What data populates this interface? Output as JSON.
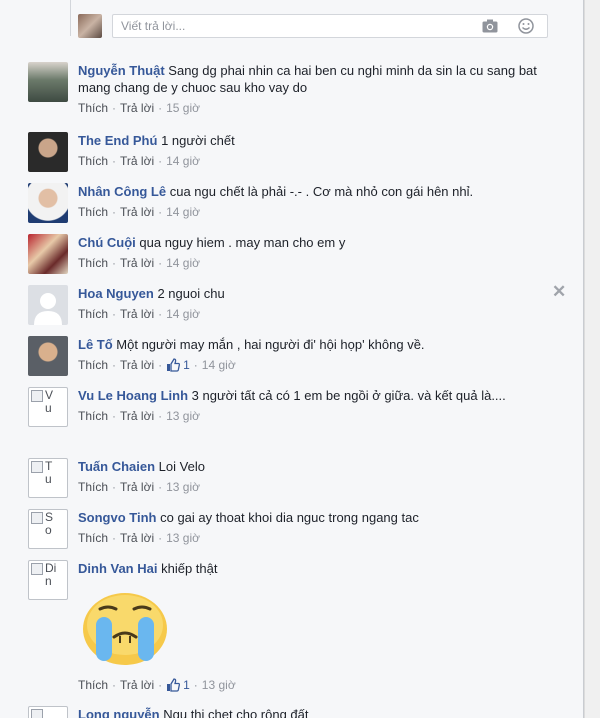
{
  "reply": {
    "placeholder": "Viết trả lời..."
  },
  "labels": {
    "like": "Thích",
    "reply": "Trả lời",
    "sep": "·"
  },
  "comments": [
    {
      "author": "Nguyễn Thuật",
      "text": "Sang dg phai nhin ca hai ben cu nghi minh da sin la cu sang bat mang chang de y chuoc sau kho vay do",
      "time": "15 giờ",
      "likes": ""
    },
    {
      "author": "The End Phú",
      "text": "1 người chết",
      "time": "14 giờ",
      "likes": ""
    },
    {
      "author": "Nhân Công Lê",
      "text": "cua ngu chết là phải -.- . Cơ mà nhỏ con gái hên nhỉ.",
      "time": "14 giờ",
      "likes": ""
    },
    {
      "author": "Chú Cuội",
      "text": "qua nguy hiem . may man cho em y",
      "time": "14 giờ",
      "likes": ""
    },
    {
      "author": "Hoa Nguyen",
      "text": "2 nguoi chu",
      "time": "14 giờ",
      "likes": ""
    },
    {
      "author": "Lê Tố",
      "text": "Một người may mắn , hai người đi' hội họp' không về.",
      "time": "14 giờ",
      "likes": "1"
    },
    {
      "author": "Vu Le Hoang Linh",
      "text": "3 người tất cả có 1 em be ngồi ở giữa. và kết quả là....",
      "time": "13 giờ",
      "likes": "",
      "alt": "Vu"
    },
    {
      "author": "Tuấn Chaien",
      "text": "Loi Velo",
      "time": "13 giờ",
      "likes": "",
      "alt": "Tu"
    },
    {
      "author": "Songvo Tinh",
      "text": "co gai ay thoat khoi dia nguc trong ngang tac",
      "time": "13 giờ",
      "likes": "",
      "alt": "So"
    },
    {
      "author": "Dinh Van Hai",
      "text": "khiếp thật",
      "time": "13 giờ",
      "likes": "1",
      "alt": "Din"
    },
    {
      "author": "Long nguyễn",
      "text": "Ngu thi chet cho rộng đất",
      "time": "",
      "likes": ""
    }
  ],
  "colors": {
    "link": "#365899",
    "meta": "#90949c",
    "bg": "#f6f7f9"
  }
}
